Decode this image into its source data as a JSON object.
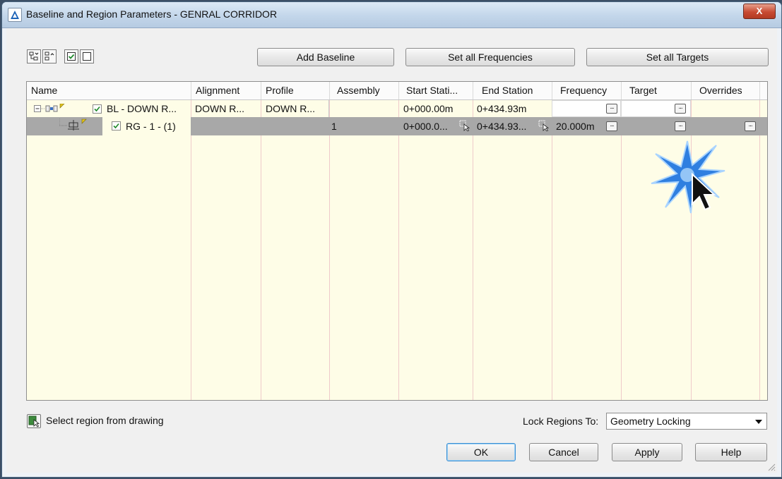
{
  "window": {
    "title": "Baseline and Region Parameters - GENRAL CORRIDOR",
    "close_label": "X"
  },
  "toolbar": {
    "icons": [
      "collapse-tree-icon",
      "expand-tree-icon",
      "check-all-icon",
      "uncheck-all-icon"
    ],
    "add_baseline": "Add Baseline",
    "set_frequencies": "Set all Frequencies",
    "set_targets": "Set all Targets"
  },
  "grid": {
    "columns": [
      "Name",
      "Alignment",
      "Profile",
      "Assembly",
      "Start Stati...",
      "End Station",
      "Frequency",
      "Target",
      "Overrides"
    ],
    "rows": [
      {
        "name": "BL - DOWN R...",
        "alignment": "DOWN R...",
        "profile": "DOWN R...",
        "assembly": "",
        "start": "0+000.00m",
        "end": "0+434.93m",
        "frequency": "",
        "checked": true
      },
      {
        "name": "RG - 1 - (1)",
        "alignment": "",
        "profile": "",
        "assembly": "1",
        "start": "0+000.0...",
        "end": "0+434.93...",
        "frequency": "20.000m",
        "checked": true
      }
    ]
  },
  "footer": {
    "select_region": "Select region from drawing",
    "lock_label": "Lock Regions To:",
    "lock_value": "Geometry Locking",
    "ok": "OK",
    "cancel": "Cancel",
    "apply": "Apply",
    "help": "Help"
  },
  "colors": {
    "grid_bg": "#fefde7",
    "selected_row": "#a8a8a8",
    "column_line": "#efcaca",
    "title_gradient": "#c3d6ea"
  }
}
